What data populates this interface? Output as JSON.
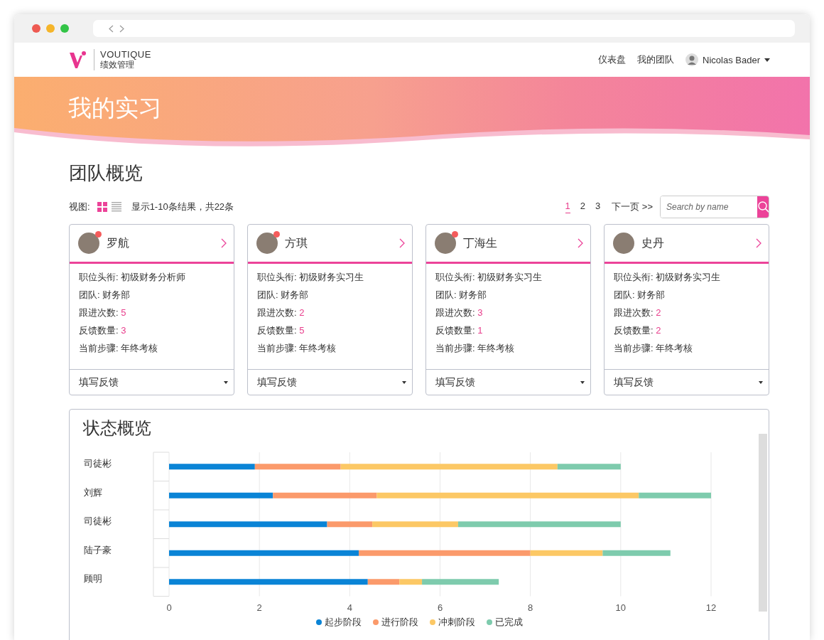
{
  "brand": {
    "name": "VOUTIQUE",
    "subtitle": "绩效管理"
  },
  "nav": {
    "links": [
      "仪表盘",
      "我的团队"
    ],
    "user": "Nicolas Bader"
  },
  "banner": {
    "title": "我的实习"
  },
  "team_overview": {
    "title": "团队概览",
    "view_label": "视图:",
    "views": [
      {
        "kind": "grid",
        "selected": true
      },
      {
        "kind": "list",
        "selected": false
      }
    ],
    "results": "显示1-10条结果，共22条",
    "pages": [
      {
        "label": "1",
        "selected": true
      },
      {
        "label": "2",
        "selected": false
      },
      {
        "label": "3",
        "selected": false
      }
    ],
    "next": "下一页 >>",
    "search": {
      "placeholder": "Search by name"
    }
  },
  "members": [
    {
      "name": "罗航",
      "unread": true,
      "fields": [
        {
          "label": "职位头衔:",
          "value": "初级财务分析师",
          "kind": "text"
        },
        {
          "label": "团队:",
          "value": "财务部",
          "kind": "text"
        },
        {
          "label": "跟进次数:",
          "value": "5",
          "kind": "count"
        },
        {
          "label": "反馈数量:",
          "value": "3",
          "kind": "count"
        },
        {
          "label": "当前步骤:",
          "value": "年终考核",
          "kind": "text"
        }
      ],
      "action": "填写反馈"
    },
    {
      "name": "方琪",
      "unread": true,
      "fields": [
        {
          "label": "职位头衔:",
          "value": "初级财务实习生",
          "kind": "text"
        },
        {
          "label": "团队:",
          "value": "财务部",
          "kind": "text"
        },
        {
          "label": "跟进次数:",
          "value": "2",
          "kind": "count"
        },
        {
          "label": "反馈数量:",
          "value": "5",
          "kind": "count"
        },
        {
          "label": "当前步骤:",
          "value": "年终考核",
          "kind": "text"
        }
      ],
      "action": "填写反馈"
    },
    {
      "name": "丁海生",
      "unread": true,
      "fields": [
        {
          "label": "职位头衔:",
          "value": "初级财务实习生",
          "kind": "text"
        },
        {
          "label": "团队:",
          "value": "财务部",
          "kind": "text"
        },
        {
          "label": "跟进次数:",
          "value": "3",
          "kind": "count"
        },
        {
          "label": "反馈数量:",
          "value": "1",
          "kind": "count"
        },
        {
          "label": "当前步骤:",
          "value": "年终考核",
          "kind": "text"
        }
      ],
      "action": "填写反馈"
    },
    {
      "name": "史丹",
      "unread": false,
      "fields": [
        {
          "label": "职位头衔:",
          "value": "初级财务实习生",
          "kind": "text"
        },
        {
          "label": "团队:",
          "value": "财务部",
          "kind": "text"
        },
        {
          "label": "跟进次数:",
          "value": "2",
          "kind": "count"
        },
        {
          "label": "反馈数量:",
          "value": "2",
          "kind": "count"
        },
        {
          "label": "当前步骤:",
          "value": "年终考核",
          "kind": "text"
        }
      ],
      "action": "填写反馈"
    }
  ],
  "status_overview": {
    "title": "状态概览",
    "chart_data": {
      "type": "bar",
      "orientation": "horizontal",
      "stacked": true,
      "categories": [
        "司徒彬",
        "刘辉",
        "司徒彬",
        "陆子豪",
        "顾明"
      ],
      "series": [
        {
          "name": "起步阶段",
          "color": "#0a84d6",
          "values": [
            1.9,
            2.3,
            3.5,
            4.2,
            4.4
          ]
        },
        {
          "name": "进行阶段",
          "color": "#fb9a6b",
          "values": [
            1.9,
            2.3,
            1.0,
            3.8,
            0.7
          ]
        },
        {
          "name": "冲刺阶段",
          "color": "#fcc865",
          "values": [
            4.8,
            5.8,
            1.9,
            1.6,
            0.5
          ]
        },
        {
          "name": "已完成",
          "color": "#7ecbad",
          "values": [
            1.4,
            1.6,
            3.6,
            1.5,
            1.7
          ]
        }
      ],
      "grid": true,
      "xlim": [
        0,
        12
      ],
      "xticks": [
        0,
        2,
        4,
        6,
        8,
        10,
        12
      ]
    }
  }
}
